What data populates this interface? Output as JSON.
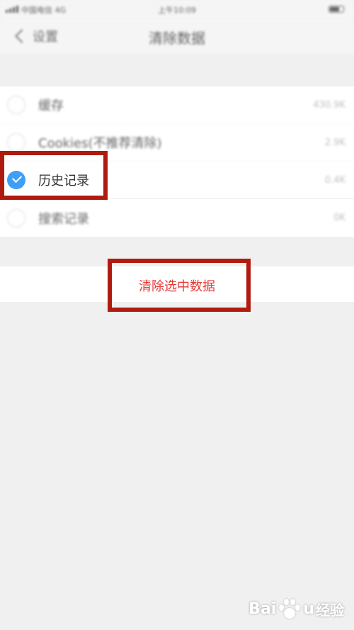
{
  "status_bar": {
    "carrier": "中国电信",
    "network": "4G",
    "time": "上午10:09"
  },
  "nav": {
    "back_label": "设置",
    "title": "清除数据"
  },
  "items": [
    {
      "label": "缓存",
      "size": "430.9K",
      "checked": false
    },
    {
      "label": "Cookies(不推荐清除)",
      "size": "2.9K",
      "checked": false
    },
    {
      "label": "历史记录",
      "size": "0.4K",
      "checked": true
    },
    {
      "label": "搜索记录",
      "size": "0K",
      "checked": false
    }
  ],
  "clear_button": {
    "label": "清除选中数据"
  },
  "watermark": {
    "brand": "Bai",
    "brand_end": "u",
    "sub": "经验"
  },
  "colors": {
    "accent": "#3d9ff6",
    "danger_text": "#e53935",
    "highlight": "#b01b10"
  }
}
